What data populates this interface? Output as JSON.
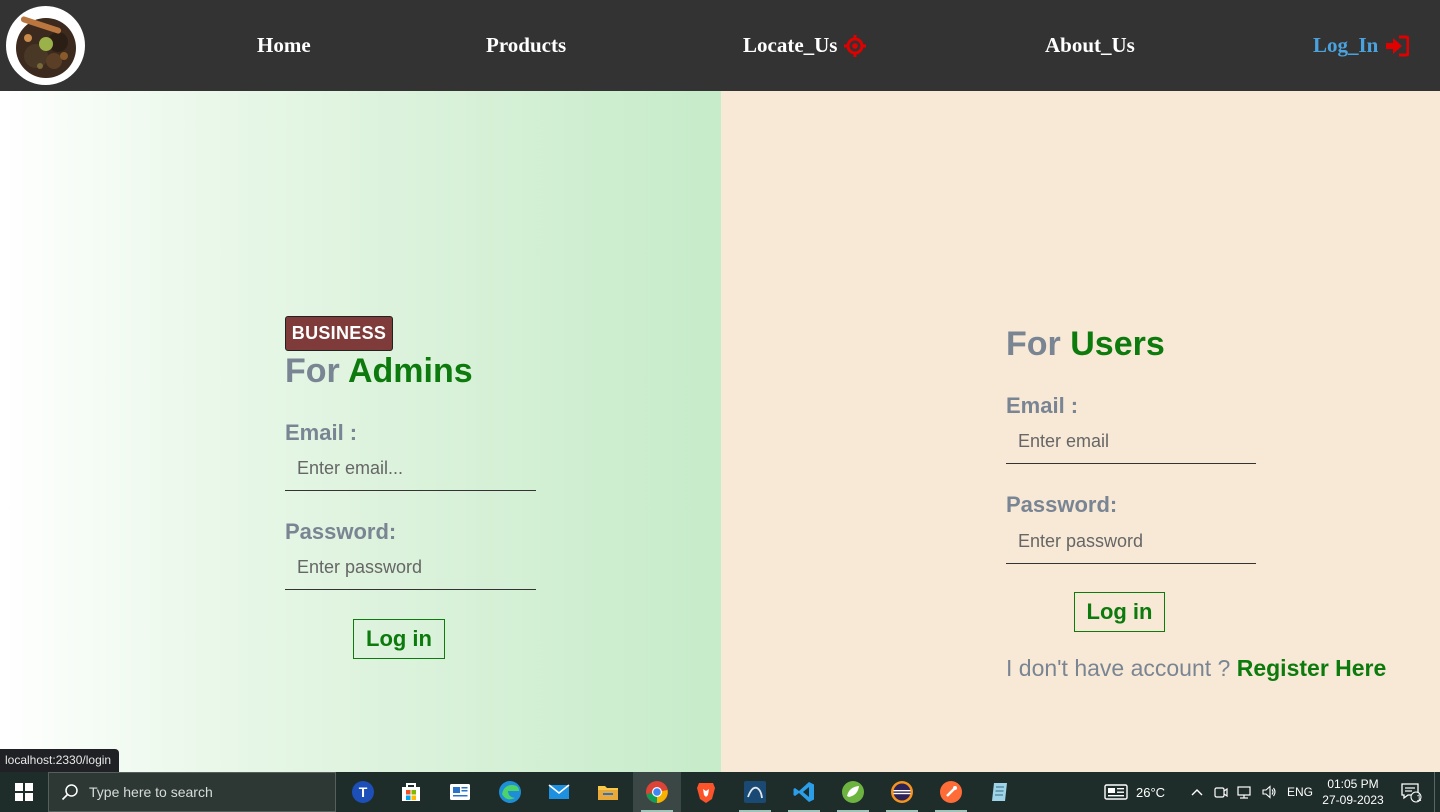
{
  "nav": {
    "home": "Home",
    "products": "Products",
    "locate": "Locate_Us",
    "about": "About_Us",
    "login": "Log_In"
  },
  "admin": {
    "badge": "BUSINESS",
    "heading_prefix": "For",
    "heading_accent": "Admins",
    "email_label": "Email :",
    "email_placeholder": "Enter email...",
    "password_label": "Password:",
    "password_placeholder": "Enter password",
    "login_button": "Log in"
  },
  "user": {
    "heading_prefix": "For",
    "heading_accent": "Users",
    "email_label": "Email :",
    "email_placeholder": "Enter email",
    "password_label": "Password:",
    "password_placeholder": "Enter password",
    "login_button": "Log in",
    "register_prompt": "I don't have account ?",
    "register_link": "Register Here"
  },
  "status_url": "localhost:2330/login",
  "taskbar": {
    "search_placeholder": "Type here to search",
    "weather": "26°C",
    "language": "ENG",
    "time": "01:05 PM",
    "date": "27-09-2023",
    "notification_count": "1"
  },
  "colors": {
    "navbar": "#333333",
    "accent_green": "#0c7a0c",
    "login_blue": "#4aa3df",
    "icon_red": "#e00000",
    "badge": "#7f3a3a",
    "user_panel": "#f8e9d7"
  }
}
